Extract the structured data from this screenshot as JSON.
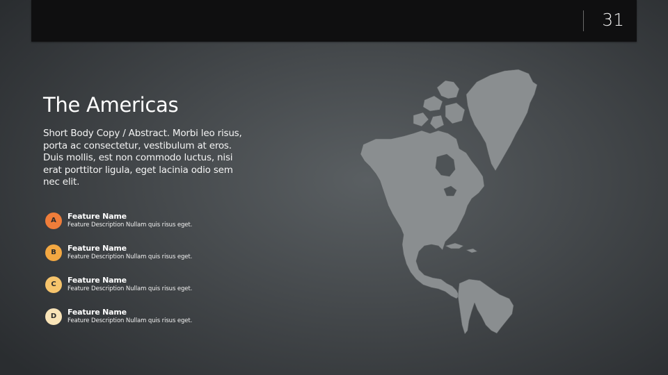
{
  "header": {
    "page_number": "31"
  },
  "slide": {
    "title": "The Americas",
    "body": "Short Body Copy / Abstract.  Morbi leo risus, porta ac consectetur, vestibulum at eros. Duis mollis, est non commodo luctus, nisi erat porttitor ligula, eget lacinia odio sem nec elit."
  },
  "features": [
    {
      "letter": "A",
      "name": "Feature Name",
      "description": "Feature Description Nullam quis risus eget.",
      "color": "#ef7d3a"
    },
    {
      "letter": "B",
      "name": "Feature Name",
      "description": "Feature Description Nullam quis risus eget.",
      "color": "#f3a842"
    },
    {
      "letter": "C",
      "name": "Feature Name",
      "description": "Feature Description Nullam quis risus eget.",
      "color": "#f6c46c"
    },
    {
      "letter": "D",
      "name": "Feature Name",
      "description": "Feature Description Nullam quis risus eget.",
      "color": "#f9e4b8"
    }
  ],
  "map": {
    "region": "americas-map",
    "fill": "#8a8e90",
    "stroke": "#5a5e60"
  }
}
